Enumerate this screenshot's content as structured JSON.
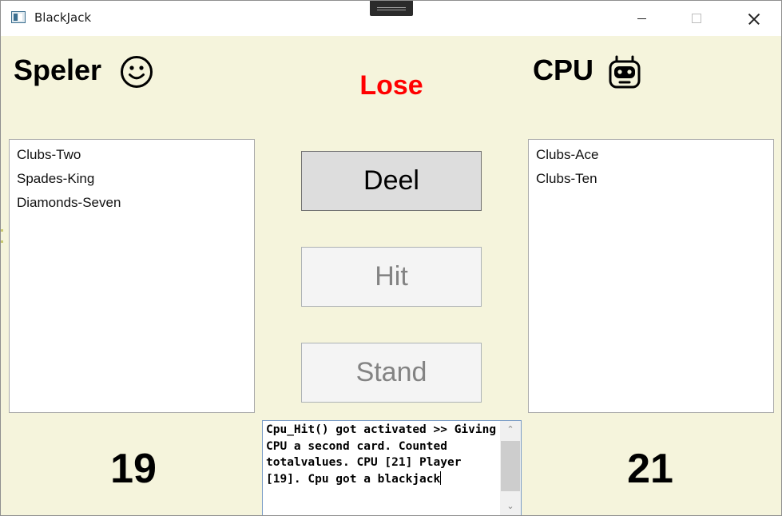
{
  "window": {
    "title": "BlackJack"
  },
  "player": {
    "label": "Speler",
    "icon": "smiley-icon",
    "cards": [
      "Clubs-Two",
      "Spades-King",
      "Diamonds-Seven"
    ],
    "score": "19"
  },
  "cpu": {
    "label": "CPU",
    "icon": "robot-icon",
    "cards": [
      "Clubs-Ace",
      "Clubs-Ten"
    ],
    "score": "21"
  },
  "result": {
    "text": "Lose",
    "color": "#ff0000"
  },
  "controls": {
    "deal_label": "Deel",
    "hit_label": "Hit",
    "stand_label": "Stand",
    "hit_enabled": false,
    "stand_enabled": false
  },
  "log": {
    "text": "Cpu_Hit() got activated >> Giving CPU a second card. Counted totalvalues. CPU [21] Player [19]. Cpu got a blackjack"
  },
  "colors": {
    "background": "#f5f4dc",
    "titlebar": "#ffffff",
    "result": "#ff0000"
  }
}
